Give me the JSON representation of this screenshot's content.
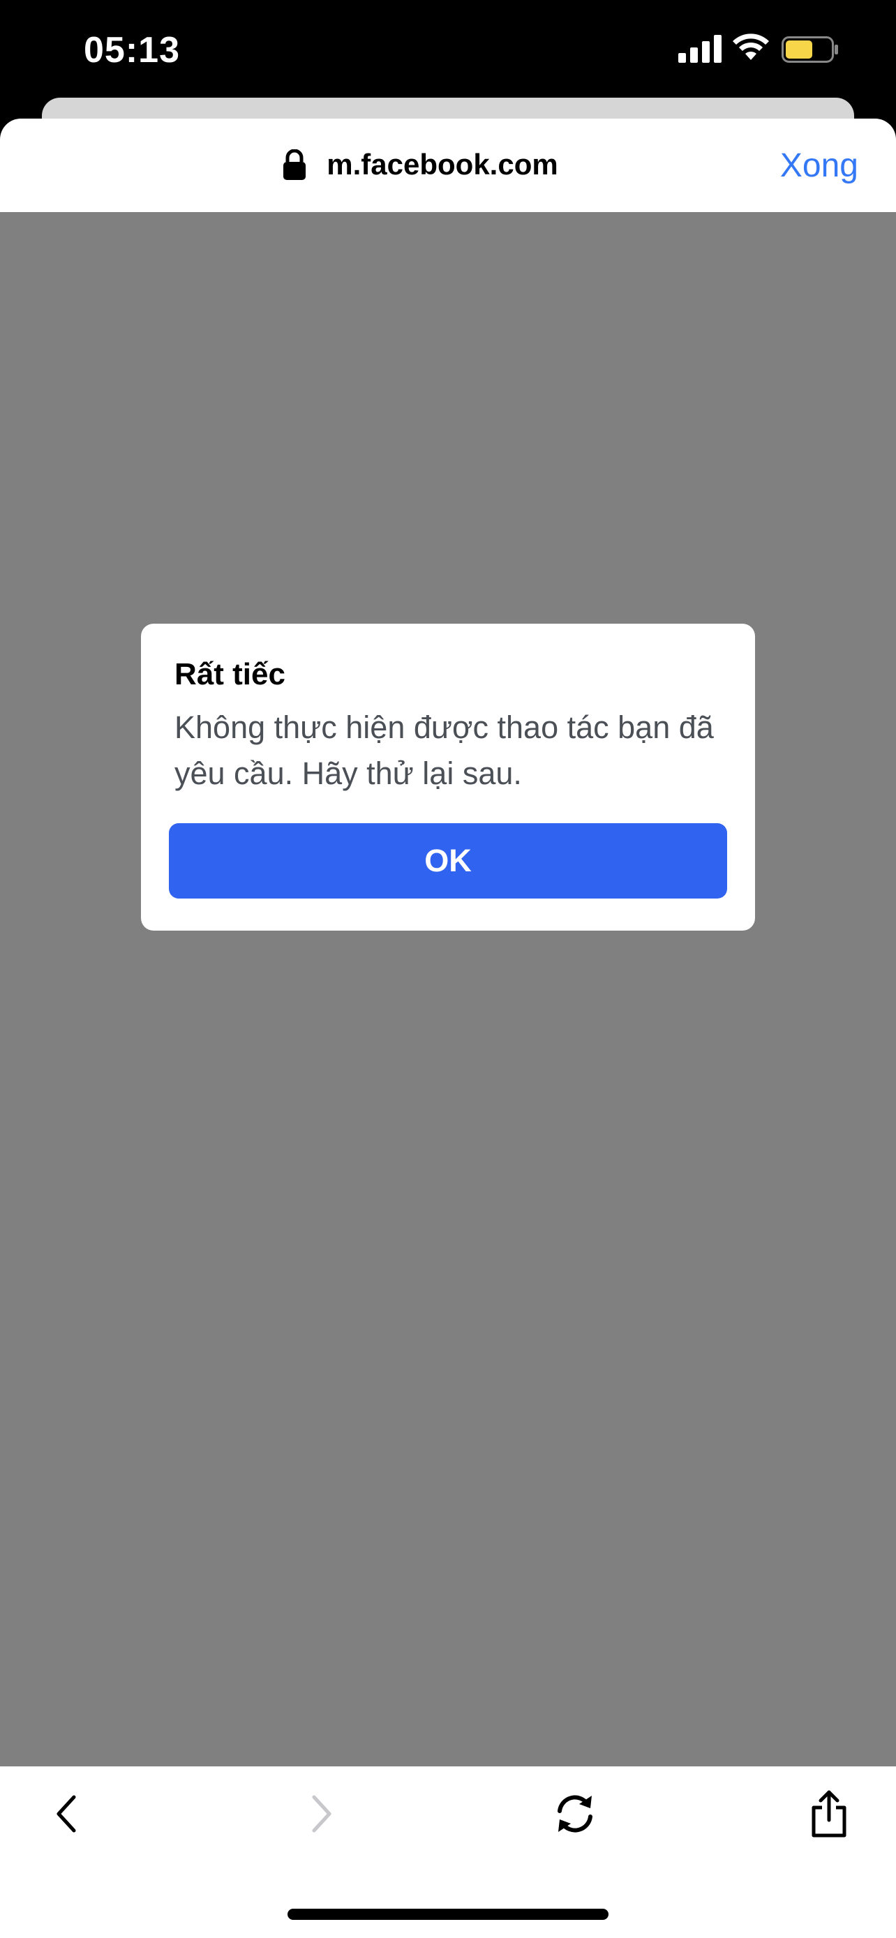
{
  "status_bar": {
    "time": "05:13"
  },
  "browser": {
    "url": "m.facebook.com",
    "done_label": "Xong"
  },
  "dialog": {
    "title": "Rất tiếc",
    "message": "Không thực hiện được thao tác bạn đã yêu cầu. Hãy thử lại sau.",
    "ok_label": "OK"
  },
  "toolbar": {
    "items": [
      {
        "icon": "back-chevron-icon",
        "enabled": true
      },
      {
        "icon": "forward-chevron-icon",
        "enabled": false
      },
      {
        "icon": "reload-icon",
        "enabled": true
      },
      {
        "icon": "share-icon",
        "enabled": true
      }
    ]
  },
  "colors": {
    "accent": "#3478f6",
    "button": "#3064f0",
    "overlay": "#808080"
  }
}
